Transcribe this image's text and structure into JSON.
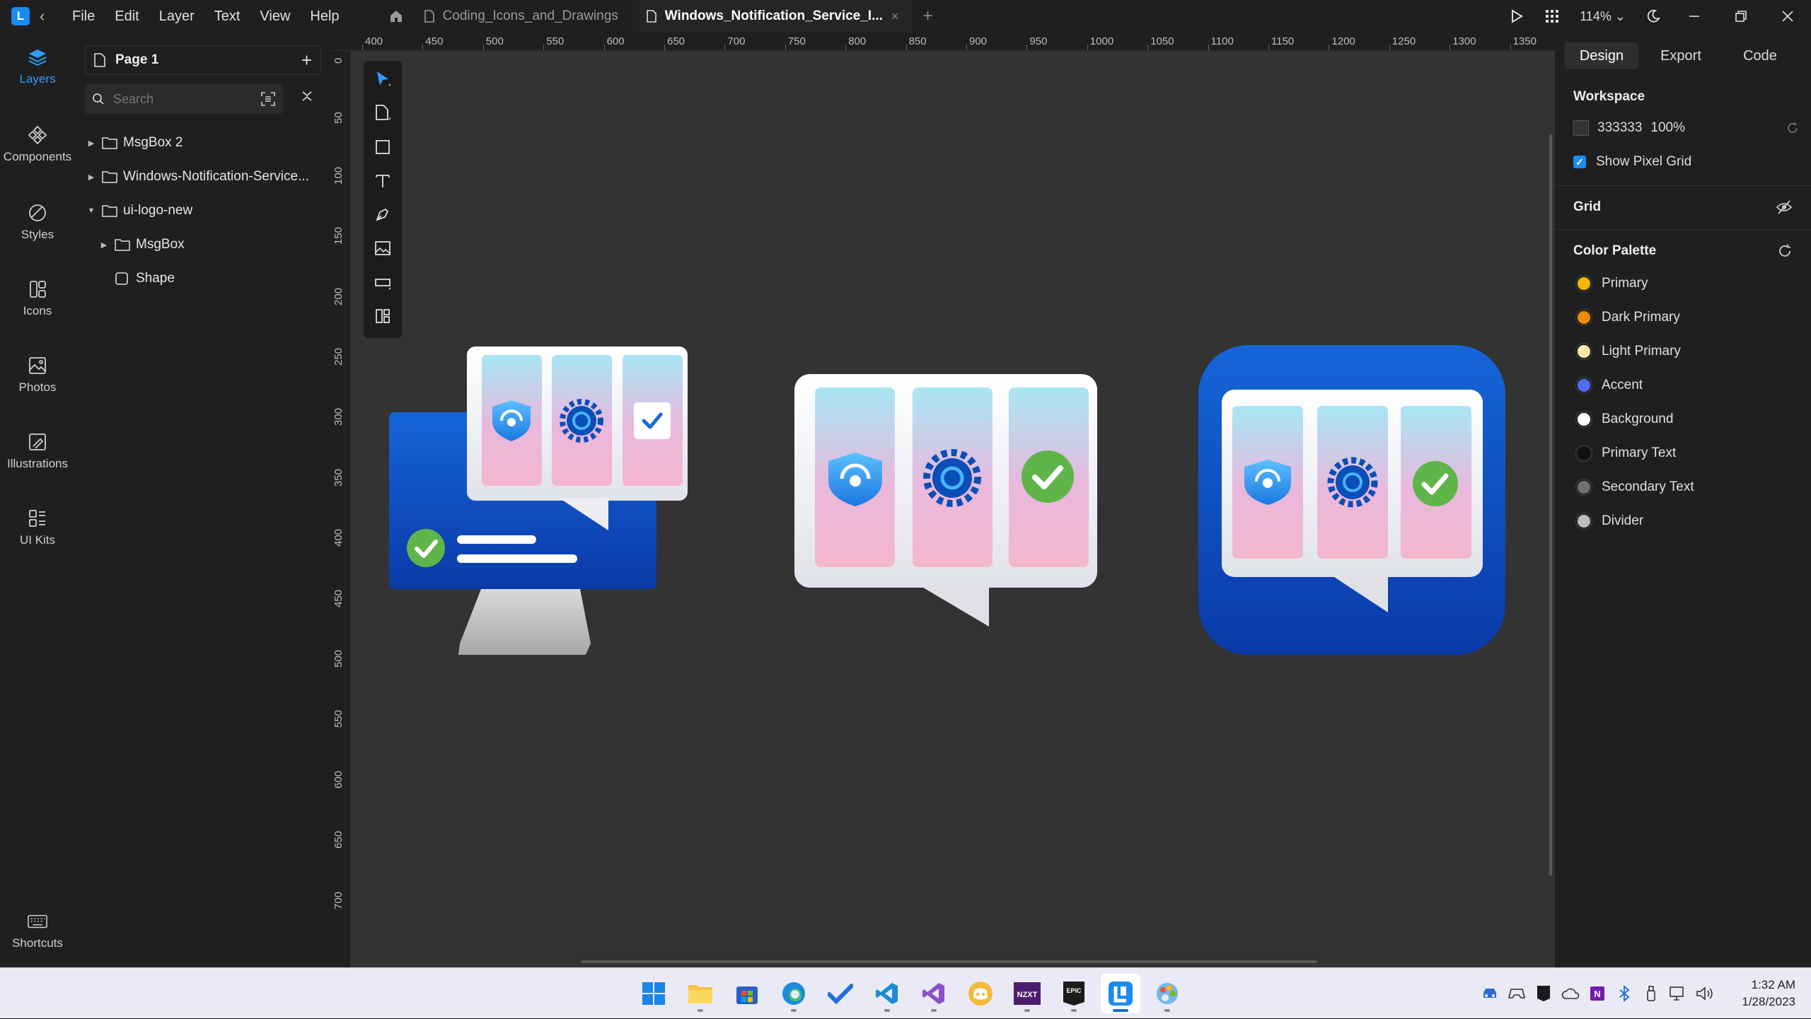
{
  "titlebar": {
    "menu": [
      "File",
      "Edit",
      "Layer",
      "Text",
      "View",
      "Help"
    ],
    "tabs": [
      {
        "label": "Coding_Icons_and_Drawings",
        "active": false
      },
      {
        "label": "Windows_Notification_Service_I...",
        "active": true
      }
    ],
    "close_glyph": "×",
    "add_tab": "+",
    "zoom": "114%"
  },
  "rail": [
    {
      "label": "Layers",
      "icon": "layers-icon",
      "active": true
    },
    {
      "label": "Components",
      "icon": "components-icon"
    },
    {
      "label": "Styles",
      "icon": "styles-icon"
    },
    {
      "label": "Icons",
      "icon": "icons-icon"
    },
    {
      "label": "Photos",
      "icon": "photos-icon"
    },
    {
      "label": "Illustrations",
      "icon": "illustrations-icon"
    },
    {
      "label": "UI Kits",
      "icon": "ui-kits-icon"
    },
    {
      "label": "Shortcuts",
      "icon": "keyboard-icon"
    }
  ],
  "layers": {
    "page": "Page 1",
    "search_placeholder": "Search",
    "items": [
      {
        "label": "MsgBox 2",
        "type": "folder",
        "expanded": false
      },
      {
        "label": "Windows-Notification-Service...",
        "type": "folder",
        "expanded": false
      },
      {
        "label": "ui-logo-new",
        "type": "folder",
        "expanded": true
      },
      {
        "label": "MsgBox",
        "type": "folder",
        "expanded": false
      },
      {
        "label": "Shape",
        "type": "shape"
      }
    ]
  },
  "rulers": {
    "top": [
      "400",
      "450",
      "500",
      "550",
      "600",
      "650",
      "700",
      "750",
      "800",
      "850",
      "900",
      "950",
      "1000",
      "1050",
      "1100",
      "1150",
      "1200",
      "1250",
      "1300",
      "1350"
    ],
    "left": [
      "0",
      "50",
      "100",
      "150",
      "200",
      "250",
      "300",
      "350",
      "400",
      "450",
      "500",
      "550",
      "600",
      "650",
      "700"
    ]
  },
  "toolbar": [
    "select-tool",
    "frame-tool",
    "rectangle-tool",
    "text-tool",
    "pen-tool",
    "image-tool",
    "input-tool",
    "components-tool"
  ],
  "right_panel": {
    "tabs": [
      {
        "label": "Design",
        "active": true
      },
      {
        "label": "Export"
      },
      {
        "label": "Code"
      }
    ],
    "workspace": {
      "title": "Workspace",
      "color": "333333",
      "opacity": "100%",
      "show_pixel_grid": "Show Pixel Grid",
      "checked": true
    },
    "grid_title": "Grid",
    "palette_title": "Color Palette",
    "palette": [
      {
        "name": "Primary",
        "color": "#f5b800"
      },
      {
        "name": "Dark Primary",
        "color": "#f08c00"
      },
      {
        "name": "Light Primary",
        "color": "#fde9a8"
      },
      {
        "name": "Accent",
        "color": "#4f6df5"
      },
      {
        "name": "Background",
        "color": "#ffffff"
      },
      {
        "name": "Primary Text",
        "color": "#111111"
      },
      {
        "name": "Secondary Text",
        "color": "#707070"
      },
      {
        "name": "Divider",
        "color": "#bdbdbd"
      }
    ]
  },
  "workspace_bg": "#333333",
  "accent": "#1a8bf0",
  "taskbar": {
    "apps": [
      "start-icon",
      "file-explorer-icon",
      "store-icon",
      "edge-icon",
      "todo-icon",
      "vscode-icon",
      "visual-studio-icon",
      "discord-icon",
      "nzxt-icon",
      "epic-games-icon",
      "lunacy-icon",
      "paint-icon"
    ],
    "time": "1:32 AM",
    "date": "1/28/2023"
  }
}
